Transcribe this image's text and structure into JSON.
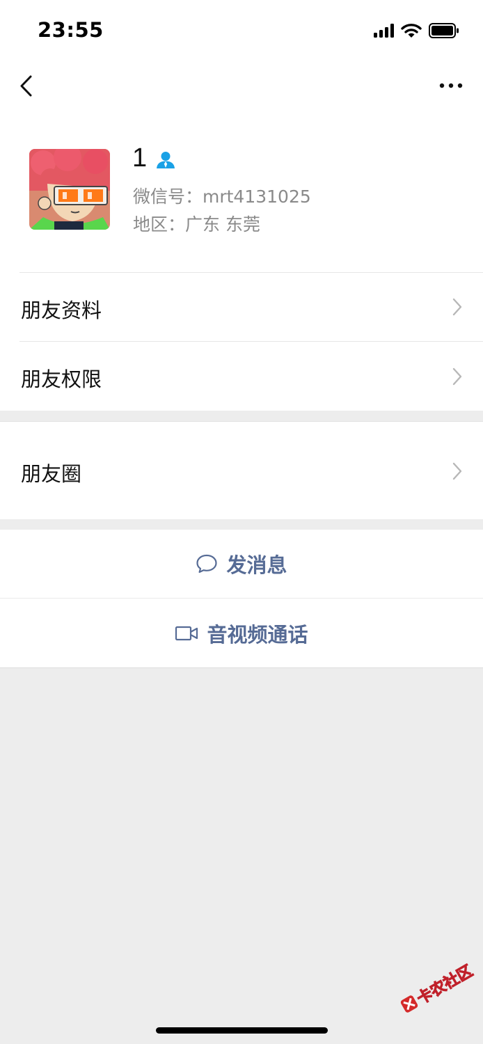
{
  "status_bar": {
    "time": "23:55"
  },
  "profile": {
    "nickname": "1",
    "wechat_id": "微信号：mrt4131025",
    "region": "地区：广东 东莞"
  },
  "menu": {
    "friend_info": "朋友资料",
    "friend_permissions": "朋友权限",
    "moments": "朋友圈"
  },
  "actions": {
    "send_message": "发消息",
    "av_call": "音视频通话"
  },
  "watermark": {
    "text": "卡农社区"
  },
  "colors": {
    "accent_text": "#566b95",
    "verified_icon": "#1aa1e6",
    "page_bg": "#ededed"
  },
  "icons": [
    "back-icon",
    "more-icon",
    "verified-user-icon",
    "chevron-right-icon",
    "chat-bubble-icon",
    "video-camera-icon"
  ]
}
